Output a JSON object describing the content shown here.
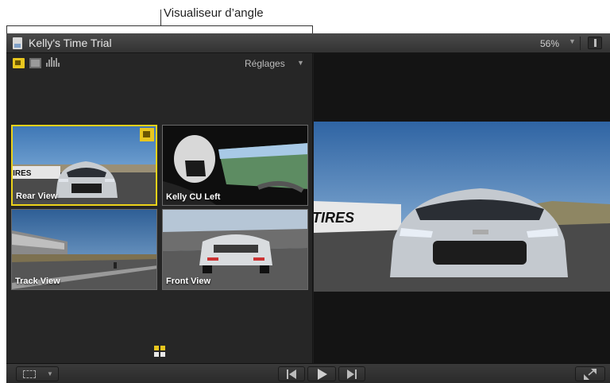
{
  "callout": {
    "label": "Visualiseur d’angle"
  },
  "window": {
    "title": "Kelly's Time Trial",
    "zoom": "56%"
  },
  "angle_viewer": {
    "settings_label": "Réglages",
    "clips": [
      {
        "label": "Rear View",
        "active": true
      },
      {
        "label": "Kelly CU Left",
        "active": false
      },
      {
        "label": "Track View",
        "active": false
      },
      {
        "label": "Front View",
        "active": false
      }
    ],
    "banner_text": "TIRES"
  },
  "main_viewer": {
    "banner_text": "TIRES"
  },
  "colors": {
    "accent": "#ecd21a",
    "background": "#1e1e1e"
  },
  "icons": {
    "doc": "document-icon",
    "zoom_menu": "chevron-down-icon",
    "view_options": "viewer-options-icon",
    "mode_av": "audio-video-switch-icon",
    "mode_video": "video-only-icon",
    "mode_audio": "audio-only-icon",
    "bank": "angle-bank-icon",
    "prev": "go-to-start-icon",
    "play": "play-icon",
    "next": "go-to-end-icon",
    "fullscreen": "fullscreen-icon"
  }
}
